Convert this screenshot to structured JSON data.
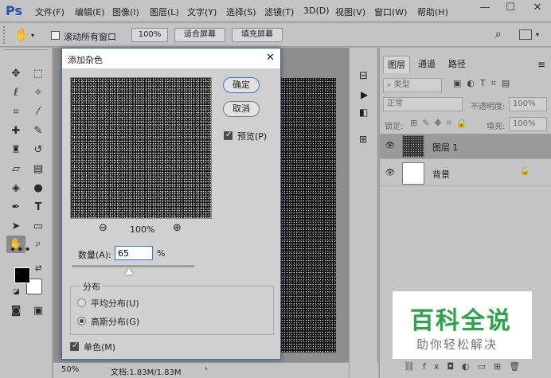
{
  "app": {
    "logo": "Ps"
  },
  "menu": [
    "文件(F)",
    "编辑(E)",
    "图像(I)",
    "图层(L)",
    "文字(Y)",
    "选择(S)",
    "滤镜(T)",
    "3D(D)",
    "视图(V)",
    "窗口(W)",
    "帮助(H)"
  ],
  "window_buttons": {
    "minimize": "—",
    "maximize": "☐",
    "close": "✕"
  },
  "options_bar": {
    "scroll_all_label": "滚动所有窗口",
    "zoom_btn": "100%",
    "fit_btn": "适合屏幕",
    "fill_btn": "填充屏幕"
  },
  "dialog": {
    "title": "添加杂色",
    "ok": "确定",
    "cancel": "取消",
    "preview_label": "预览(P)",
    "preview_checked": true,
    "zoom_out": "⊖",
    "zoom_level": "100%",
    "zoom_in": "⊕",
    "amount_label": "数量(A):",
    "amount_value": "65",
    "amount_unit": "%",
    "distribution_label": "分布",
    "uniform_label": "平均分布(U)",
    "gaussian_label": "高斯分布(G)",
    "selected_distribution": "gaussian",
    "mono_label": "单色(M)",
    "mono_checked": true
  },
  "status": {
    "zoom": "50%",
    "doc_info": "文档:1.83M/1.83M"
  },
  "layers_panel": {
    "tabs": [
      "图层",
      "通道",
      "路径"
    ],
    "filter_kind": "类型",
    "blend_mode": "正常",
    "opacity_label": "不透明度:",
    "opacity_value": "100%",
    "lock_label": "锁定:",
    "fill_label": "填充:",
    "fill_value": "100%",
    "layers": [
      {
        "name": "图层 1",
        "selected": true
      },
      {
        "name": "背景",
        "selected": false,
        "locked": true
      }
    ]
  },
  "watermark": {
    "title": "百科全说",
    "subtitle": "助你轻松解决"
  },
  "colors": {
    "accent": "#3a74d6",
    "watermark_green": "#27a745",
    "logo": "#1c4fbf"
  }
}
